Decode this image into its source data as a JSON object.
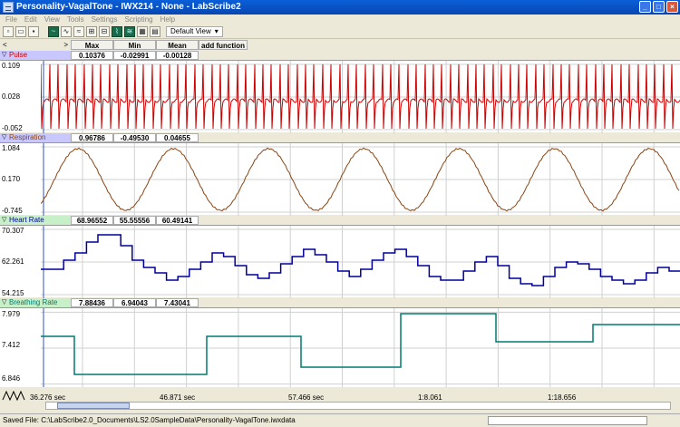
{
  "window": {
    "title": "Personality-VagalTone - IWX214 - None - LabScribe2"
  },
  "menu": [
    "File",
    "Edit",
    "View",
    "Tools",
    "Settings",
    "Scripting",
    "Help"
  ],
  "toolbar": {
    "view_label": "Default View"
  },
  "header": {
    "max_label": "Max",
    "min_label": "Min",
    "mean_label": "Mean",
    "add_function_label": "add function"
  },
  "channels": [
    {
      "name": "Pulse",
      "max": "0.10376",
      "min": "-0.02991",
      "mean": "-0.00128",
      "ymax": "0.109",
      "ymid": "0.028",
      "ymin": "-0.052",
      "color": "#cc0000"
    },
    {
      "name": "Respiration",
      "max": "0.96786",
      "min": "-0.49530",
      "mean": "0.04655",
      "ymax": "1.084",
      "ymid": "0.170",
      "ymin": "-0.745",
      "color": "#8b4513"
    },
    {
      "name": "Heart Rate",
      "max": "68.96552",
      "min": "55.55556",
      "mean": "60.49141",
      "ymax": "70.307",
      "ymid": "62.261",
      "ymin": "54.215",
      "color": "#000099"
    },
    {
      "name": "Breathing Rate",
      "max": "7.88436",
      "min": "6.94043",
      "mean": "7.43041",
      "ymax": "7.979",
      "ymid": "7.412",
      "ymin": "6.846",
      "color": "#007a70"
    }
  ],
  "times": [
    "36.276 sec",
    "46.871 sec",
    "57.466 sec",
    "1:8.061",
    "1:18.656"
  ],
  "status": {
    "saved_file": "Saved File: C:\\LabScribe2.0_Documents\\LS2.0SampleData\\Personality-VagalTone.iwxdata"
  }
}
